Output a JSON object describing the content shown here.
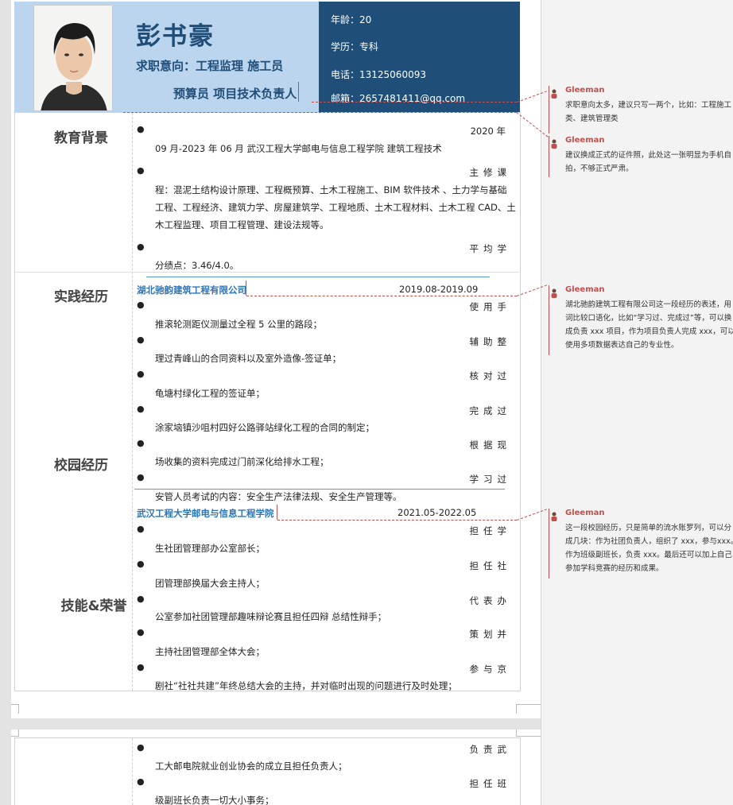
{
  "header": {
    "name": "彭书豪",
    "intent_line1": "求职意向：工程监理  施工员",
    "intent_line2": "预算员  项目技术负责人",
    "age": "年龄：20",
    "education": "学历：专科",
    "phone": "电话：13125060093",
    "email": "邮箱：2657481411@qq.com"
  },
  "sections": {
    "education": "教育背景",
    "practice": "实践经历",
    "campus": "校园经历",
    "skills": "技能&荣誉"
  },
  "education": {
    "l1": "2020 年",
    "l2": "09 月-2023 年 06 月    武汉工程大学邮电与信息工程学院    建筑工程技术",
    "l3": "主修课",
    "l4": "程：混泥土结构设计原理、工程概预算、土木工程施工、BIM 软件技术 、土力学与基础",
    "l5": "工程、工程经济、建筑力学、房屋建筑学、工程地质、土木工程材料、土木工程 CAD、土",
    "l6": "木工程监理、项目工程管理、建设法规等。",
    "l7": "平均学",
    "l8": "分绩点：3.46/4.0。"
  },
  "practice": {
    "company": "湖北驰韵建筑工程有限公司",
    "date": "2019.08-2019.09",
    "items": [
      {
        "a": "使用手",
        "b": "推滚轮测距仪测量过全程 5 公里的路段；"
      },
      {
        "a": "辅助整",
        "b": "理过青峰山的合同资料以及室外造像-签证单；"
      },
      {
        "a": "核对过",
        "b": "龟塘村绿化工程的签证单；"
      },
      {
        "a": "完成过",
        "b": "涂家垴镇沙咀村四好公路驿站绿化工程的合同的制定；"
      },
      {
        "a": "根据现",
        "b": "场收集的资料完成过门前深化给排水工程；"
      },
      {
        "a": "学习过",
        "b": "安管人员考试的内容：安全生产法律法规、安全生产管理等。"
      }
    ]
  },
  "campus": {
    "school": "武汉工程大学邮电与信息工程学院",
    "date": "2021.05-2022.05",
    "items": [
      {
        "a": "担任学",
        "b": "生社团管理部办公室部长；"
      },
      {
        "a": "担任社",
        "b": "团管理部换届大会主持人；"
      },
      {
        "a": "代表办",
        "b": "公室参加社团管理部趣味辩论赛且担任四辩  总结性辩手；"
      },
      {
        "a": "策划并",
        "b": "主持社团管理部全体大会；"
      },
      {
        "a": "参与京",
        "b": "剧社“社社共建”年终总结大会的主持，并对临时出现的问题进行及时处理；"
      }
    ]
  },
  "page2": {
    "items": [
      {
        "a": "负责武",
        "b": "工大邮电院就业创业协会的成立且担任负责人；"
      },
      {
        "a": "担任班",
        "b": "级副班长负责一切大小事务；"
      }
    ]
  },
  "comments": [
    {
      "author": "Gleeman",
      "text": "求职意向太多，建议只写一两个，比如：工程施工\n类、建筑管理类"
    },
    {
      "author": "Gleeman",
      "text": "建议换成正式的证件照，此处这一张明显为手机自\n拍，不够正式严肃。"
    },
    {
      "author": "Gleeman",
      "text": "湖北驰韵建筑工程有限公司这一段经历的表述，用\n词比较口语化，比如“学习过、完成过”等，可以换\n成负责 xxx 项目，作为项目负责人完成 xxx，可以\n使用多项数据表达自己的专业性。"
    },
    {
      "author": "Gleeman",
      "text": "这一段校园经历，只是简单的流水账罗列，可以分\n成几块：作为社团负责人，组织了 xxx，参与xxx。\n作为班级副班长，负责 xxx。最后还可以加上自己\n参加学科竞赛的经历和成果。"
    }
  ],
  "colors": {
    "header_light": "#bcd5ee",
    "header_dark": "#1f4e79",
    "accent_blue": "#2e75b6",
    "comment_red": "#c0504d"
  }
}
